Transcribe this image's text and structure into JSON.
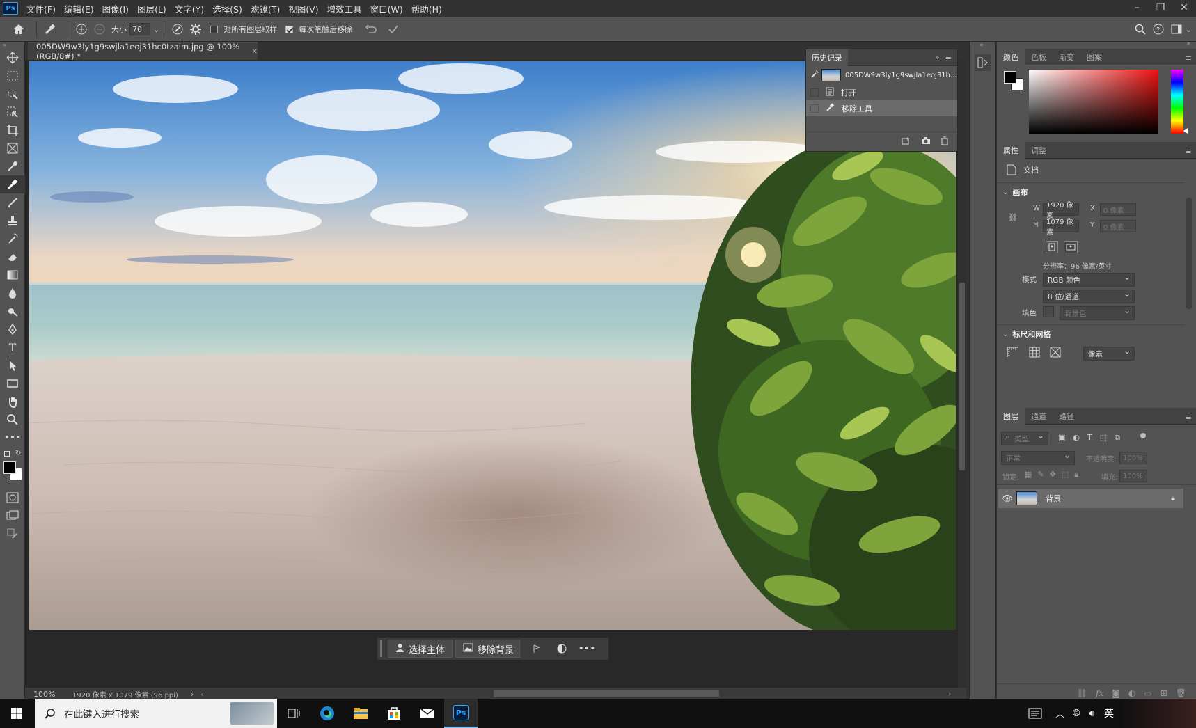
{
  "menubar": {
    "items": [
      "文件(F)",
      "编辑(E)",
      "图像(I)",
      "图层(L)",
      "文字(Y)",
      "选择(S)",
      "滤镜(T)",
      "视图(V)",
      "增效工具",
      "窗口(W)",
      "帮助(H)"
    ]
  },
  "options": {
    "size_label": "大小",
    "size_value": "70",
    "sample_all_label": "对所有图层取样",
    "remove_after_label": "每次笔触后移除",
    "sample_all_checked": false,
    "remove_after_checked": true
  },
  "document": {
    "tab_title": "005DW9w3ly1g9swjla1eoj31hc0tzaim.jpg @ 100%(RGB/8#) *",
    "zoom": "100%",
    "size_info": "1920 像素 x 1079 像素 (96 ppi)"
  },
  "context_bar": {
    "select_subject": "选择主体",
    "remove_bg": "移除背景"
  },
  "history": {
    "title": "历史记录",
    "snapshot": "005DW9w3ly1g9swjla1eoj31h...",
    "steps": [
      "打开",
      "移除工具"
    ]
  },
  "color_panel": {
    "tabs": [
      "颜色",
      "色板",
      "渐变",
      "图案"
    ]
  },
  "properties": {
    "tabs": [
      "属性",
      "调整"
    ],
    "doc_label": "文档",
    "canvas_title": "画布",
    "w_label": "W",
    "w_value": "1920 像素",
    "h_label": "H",
    "h_value": "1079 像素",
    "x_label": "X",
    "x_value": "0 像素",
    "y_label": "Y",
    "y_value": "0 像素",
    "resolution": "分辨率：96 像素/英寸",
    "mode_label": "模式",
    "mode_value": "RGB 颜色",
    "depth_value": "8 位/通道",
    "fill_label": "填色",
    "fill_value": "背景色",
    "rulers_title": "标尺和网格",
    "unit_value": "像素"
  },
  "layers": {
    "tabs": [
      "图层",
      "通道",
      "路径"
    ],
    "filter_placeholder": "类型",
    "blend_mode": "正常",
    "opacity_label": "不透明度:",
    "opacity_value": "100%",
    "lock_label": "锁定:",
    "fill_label": "填充:",
    "fill_value": "100%",
    "layer_name": "背景"
  },
  "taskbar": {
    "search_placeholder": "在此键入进行搜索",
    "ime": "英"
  }
}
